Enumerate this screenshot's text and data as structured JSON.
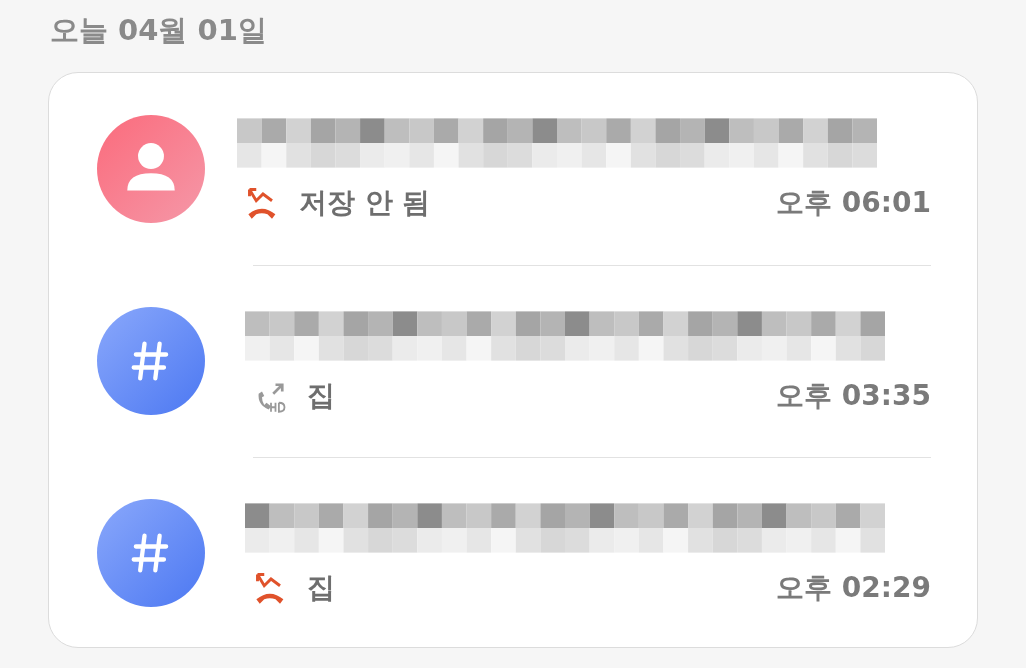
{
  "date_header": "오늘 04월 01일",
  "calls": [
    {
      "avatar": {
        "kind": "person"
      },
      "call_type": {
        "kind": "missed"
      },
      "label": "저장 안 됨",
      "time": "오후 06:01"
    },
    {
      "avatar": {
        "kind": "number"
      },
      "call_type": {
        "kind": "outgoing"
      },
      "label": "집",
      "time": "오후 03:35"
    },
    {
      "avatar": {
        "kind": "number"
      },
      "call_type": {
        "kind": "missed"
      },
      "label": "집",
      "time": "오후 02:29"
    }
  ]
}
